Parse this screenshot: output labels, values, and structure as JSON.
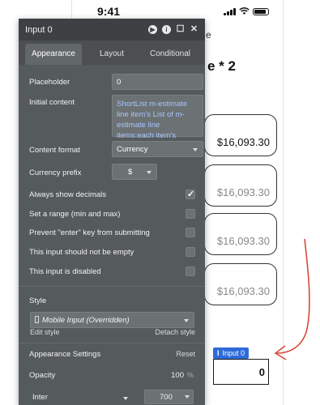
{
  "phone": {
    "time": "9:41",
    "heading_fragment": "e * 2",
    "edge_fragment": "e",
    "amounts": [
      "$16,093.30",
      "$16,093.30",
      "$16,093.30",
      "$16,093.30"
    ],
    "input_tag": "Input 0",
    "input_value": "0"
  },
  "panel": {
    "title": "Input 0",
    "tabs": [
      "Appearance",
      "Layout",
      "Conditional"
    ],
    "placeholder_label": "Placeholder",
    "placeholder_value": "0",
    "initial_label": "Initial content",
    "initial_value": "ShortList m-estimate line item's List of m-estimate line items:each item's Total:sum",
    "format_label": "Content format",
    "format_value": "Currency",
    "prefix_label": "Currency prefix",
    "prefix_value": "$",
    "decimals_label": "Always show decimals",
    "range_label": "Set a range (min and max)",
    "enter_label": "Prevent \"enter\" key from submitting",
    "not_empty_label": "This input should not be empty",
    "disabled_label": "This input is disabled",
    "style_label": "Style",
    "style_value": "Mobile Input (Overridden)",
    "edit_style": "Edit style",
    "detach_style": "Detach style",
    "appearance_settings": "Appearance Settings",
    "reset": "Reset",
    "opacity_label": "Opacity",
    "opacity_value": "100",
    "opacity_unit": "%",
    "font_value": "Inter",
    "weight_value": "700"
  }
}
